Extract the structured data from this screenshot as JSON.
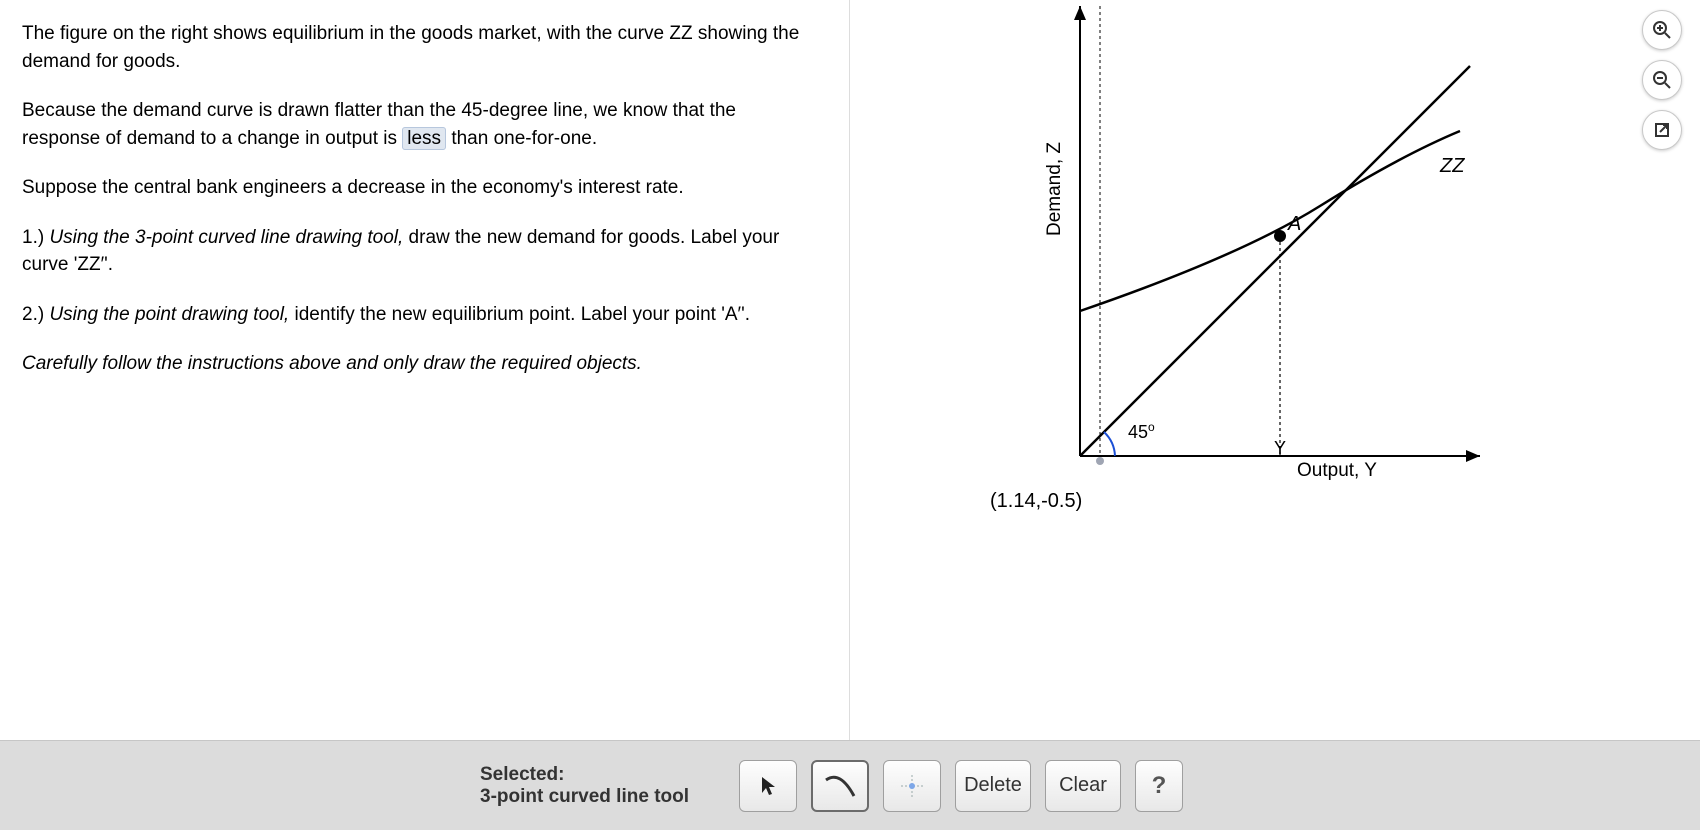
{
  "text": {
    "p1": "The figure on the right shows equilibrium in the goods market, with the curve ZZ showing the demand for goods.",
    "p2a": "Because the demand curve is drawn flatter than the 45-degree line, we know that the response of demand to a change in output is ",
    "ans": "less",
    "p2b": " than one-for-one.",
    "p3": "Suppose the central bank engineers a decrease in the economy's interest rate.",
    "q1_lead": "1.) ",
    "q1_ital": "Using the 3-point curved line drawing tool,",
    "q1_rest": " draw the new demand for goods. Label your curve 'ZZ′'.",
    "q2_lead": "2.) ",
    "q2_ital": "Using the point drawing tool,",
    "q2_rest": " identify the new equilibrium point. Label your point 'A′'.",
    "note": "Carefully follow the instructions above and only draw the required objects."
  },
  "chart": {
    "y_axis_label": "Demand, Z",
    "x_axis_label": "Output, Y",
    "angle_label": "45°",
    "point_label": "A",
    "zz_label": "ZZ",
    "y_tick": "Y",
    "cursor_coord": "(1.14,-0.5)"
  },
  "toolbar": {
    "selected_label": "Selected:",
    "selected_tool": "3-point curved line tool",
    "delete": "Delete",
    "clear": "Clear",
    "help": "?"
  },
  "chart_data": {
    "type": "line",
    "xlim": [
      0,
      10
    ],
    "ylim": [
      0,
      10
    ],
    "series": [
      {
        "name": "45-degree",
        "x": [
          0,
          10
        ],
        "y": [
          0,
          10
        ]
      },
      {
        "name": "ZZ",
        "x": [
          0,
          2,
          4,
          6,
          8,
          9.5
        ],
        "y": [
          3.3,
          3.9,
          4.7,
          5.6,
          6.6,
          7.4
        ]
      }
    ],
    "points": [
      {
        "name": "A",
        "x": 5,
        "y": 5
      }
    ],
    "xlabel": "Output, Y",
    "ylabel": "Demand, Z",
    "annotations": [
      {
        "text": "45°",
        "x": 0.8,
        "y": 0.4
      }
    ]
  }
}
